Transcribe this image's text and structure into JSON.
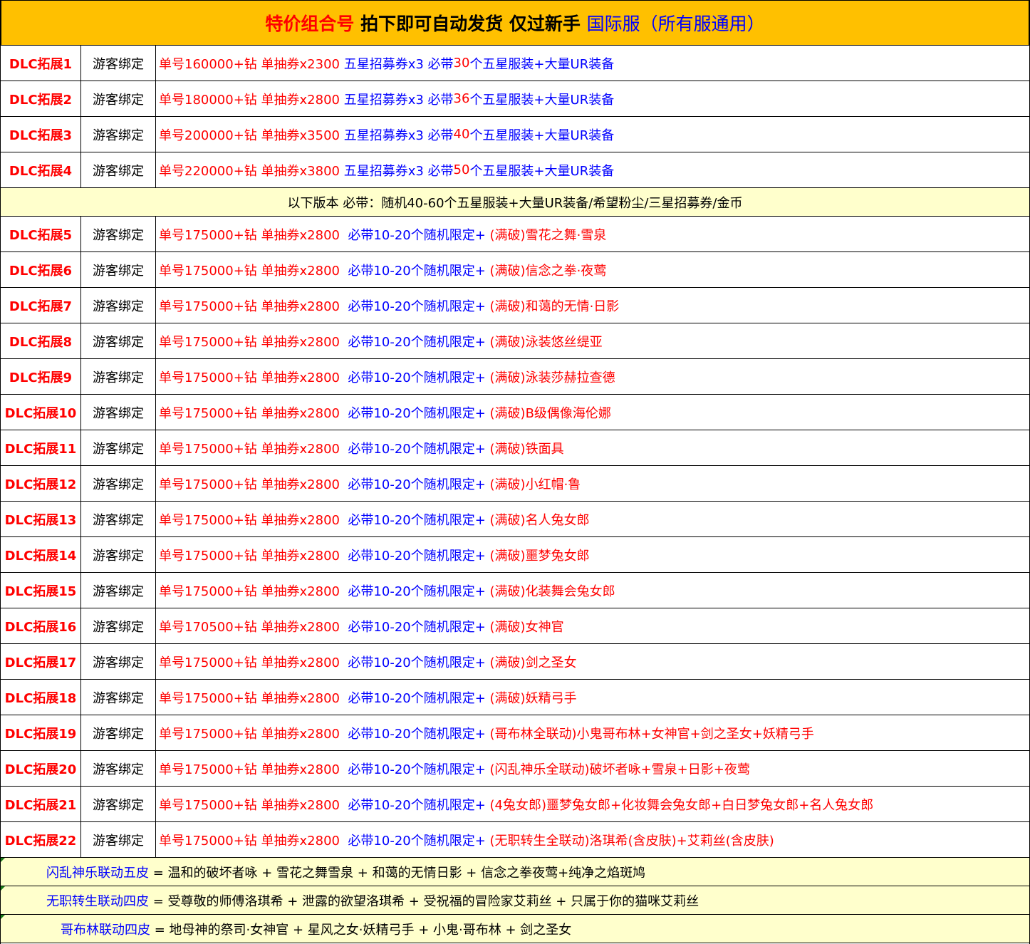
{
  "header": {
    "part1": "特价组合号",
    "part2": " 拍下即可自动发货 仅过新手 ",
    "part3": "国际服（所有服通用）"
  },
  "group_a": [
    {
      "name": "DLC拓展1",
      "bind": "游客绑定",
      "a": "单号160000+钻 单抽券x2300 ",
      "b": "五星招募券x3 必带",
      "n": "30",
      "c": "个五星服装+大量UR装备"
    },
    {
      "name": "DLC拓展2",
      "bind": "游客绑定",
      "a": "单号180000+钻 单抽券x2800 ",
      "b": "五星招募券x3 必带",
      "n": "36",
      "c": "个五星服装+大量UR装备"
    },
    {
      "name": "DLC拓展3",
      "bind": "游客绑定",
      "a": "单号200000+钻 单抽券x3500 ",
      "b": "五星招募券x3 必带",
      "n": "40",
      "c": "个五星服装+大量UR装备"
    },
    {
      "name": "DLC拓展4",
      "bind": "游客绑定",
      "a": "单号220000+钻 单抽券x3800 ",
      "b": "五星招募券x3 必带",
      "n": "50",
      "c": "个五星服装+大量UR装备"
    }
  ],
  "note": "以下版本 必带：随机40-60个五星服装+大量UR装备/希望粉尘/三星招募券/金币",
  "group_b_common": {
    "bind": "游客绑定",
    "mid": "必带10-20个随机限定+"
  },
  "group_b": [
    {
      "name": "DLC拓展5",
      "a": "单号175000+钻 单抽券x2800  ",
      "c": " (满破)雪花之舞·雪泉"
    },
    {
      "name": "DLC拓展6",
      "a": "单号175000+钻 单抽券x2800  ",
      "c": " (满破)信念之拳·夜莺"
    },
    {
      "name": "DLC拓展7",
      "a": "单号175000+钻 单抽券x2800  ",
      "c": " (满破)和蔼的无情·日影"
    },
    {
      "name": "DLC拓展8",
      "a": "单号175000+钻 单抽券x2800  ",
      "c": " (满破)泳装悠丝缇亚"
    },
    {
      "name": "DLC拓展9",
      "a": "单号175000+钻 单抽券x2800  ",
      "c": " (满破)泳装莎赫拉查德"
    },
    {
      "name": "DLC拓展10",
      "a": "单号175000+钻 单抽券x2800  ",
      "c": " (满破)B级偶像海伦娜"
    },
    {
      "name": "DLC拓展11",
      "a": "单号175000+钻 单抽券x2800  ",
      "c": " (满破)铁面具"
    },
    {
      "name": "DLC拓展12",
      "a": "单号175000+钻 单抽券x2800  ",
      "c": " (满破)小红帽·鲁"
    },
    {
      "name": "DLC拓展13",
      "a": "单号175000+钻 单抽券x2800  ",
      "c": " (满破)名人兔女郎"
    },
    {
      "name": "DLC拓展14",
      "a": "单号175000+钻 单抽券x2800  ",
      "c": " (满破)噩梦兔女郎"
    },
    {
      "name": "DLC拓展15",
      "a": "单号175000+钻 单抽券x2800  ",
      "c": " (满破)化装舞会兔女郎"
    },
    {
      "name": "DLC拓展16",
      "a": "单号170500+钻 单抽券x2800  ",
      "c": " (满破)女神官"
    },
    {
      "name": "DLC拓展17",
      "a": "单号175000+钻 单抽券x2800  ",
      "c": " (满破)剑之圣女"
    },
    {
      "name": "DLC拓展18",
      "a": "单号175000+钻 单抽券x2800  ",
      "c": " (满破)妖精弓手"
    },
    {
      "name": "DLC拓展19",
      "a": "单号175000+钻 单抽券x2800  ",
      "c": " (哥布林全联动)小鬼哥布林+女神官+剑之圣女+妖精弓手"
    },
    {
      "name": "DLC拓展20",
      "a": "单号175000+钻 单抽券x2800  ",
      "c": " (闪乱神乐全联动)破坏者咏+雪泉+日影+夜莺"
    },
    {
      "name": "DLC拓展21",
      "a": "单号175000+钻 单抽券x2800  ",
      "c": " (4兔女郎)噩梦兔女郎+化妆舞会兔女郎+白日梦兔女郎+名人兔女郎"
    },
    {
      "name": "DLC拓展22",
      "a": "单号175000+钻 单抽券x2800  ",
      "c": " (无职转生全联动)洛琪希(含皮肤)+艾莉丝(含皮肤)"
    }
  ],
  "footer": [
    {
      "name": "闪乱神乐联动五皮",
      "desc": " = 温和的破坏者咏 + 雪花之舞雪泉 + 和蔼的无情日影 + 信念之拳夜莺+纯净之焰斑鸠"
    },
    {
      "name": "无职转生联动四皮",
      "desc": " = 受尊敬的师傅洛琪希 + 泄露的欲望洛琪希 + 受祝福的冒险家艾莉丝 + 只属于你的猫咪艾莉丝"
    },
    {
      "name": "哥布林联动四皮",
      "desc": " = 地母神的祭司·女神官 + 星风之女·妖精弓手 + 小鬼·哥布林 + 剑之圣女"
    }
  ],
  "colors": {
    "header_bg": "#FFC000",
    "note_bg": "#FFFFCC",
    "red": "#FF0000",
    "blue": "#0000FF"
  }
}
